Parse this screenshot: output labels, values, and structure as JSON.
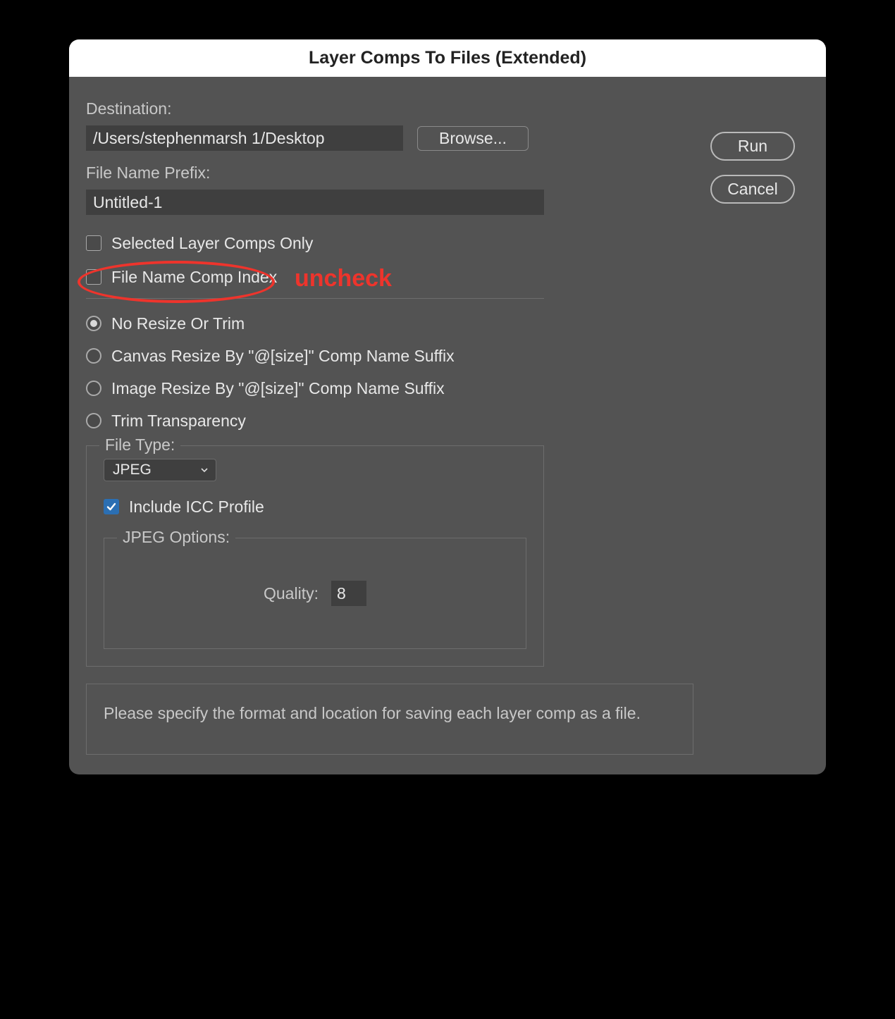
{
  "title": "Layer Comps To Files (Extended)",
  "buttons": {
    "run": "Run",
    "cancel": "Cancel",
    "browse": "Browse..."
  },
  "destination": {
    "label": "Destination:",
    "value": "/Users/stephenmarsh 1/Desktop"
  },
  "prefix": {
    "label": "File Name Prefix:",
    "value": "Untitled-1"
  },
  "checks": {
    "selected_only": "Selected Layer Comps Only",
    "comp_index": "File Name Comp Index"
  },
  "resize": {
    "none": "No Resize Or Trim",
    "canvas": "Canvas Resize By \"@[size]\" Comp Name Suffix",
    "image": "Image Resize By \"@[size]\" Comp Name Suffix",
    "trim": "Trim Transparency"
  },
  "filetype": {
    "legend": "File Type:",
    "value": "JPEG",
    "icc_label": "Include ICC Profile",
    "jpeg_legend": "JPEG Options:",
    "quality_label": "Quality:",
    "quality_value": "8"
  },
  "info": "Please specify the format and location for saving each layer comp as a file.",
  "annotation": {
    "text": "uncheck"
  }
}
